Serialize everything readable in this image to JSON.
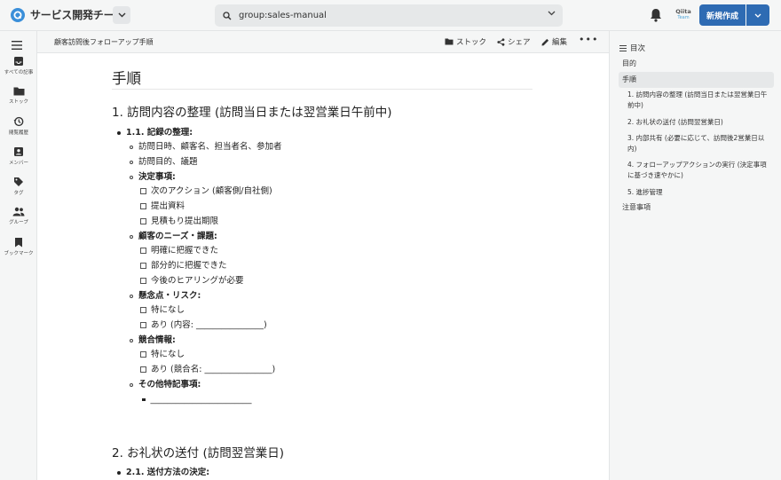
{
  "header": {
    "team_name": "サービス開発チーム",
    "search_value": "group:sales-manual",
    "qiita_brand": "Qiita",
    "qiita_sub": "Team",
    "new_button": "新規作成",
    "accent_color": "#2e6bb3"
  },
  "sidebar": {
    "items": [
      {
        "icon": "inbox-icon",
        "label": "すべての記事"
      },
      {
        "icon": "folder-icon",
        "label": "ストック"
      },
      {
        "icon": "history-icon",
        "label": "閲覧履歴"
      },
      {
        "icon": "member-icon",
        "label": "メンバー"
      },
      {
        "icon": "tag-icon",
        "label": "タグ"
      },
      {
        "icon": "group-icon",
        "label": "グループ"
      },
      {
        "icon": "bookmark-icon",
        "label": "ブックマーク"
      }
    ]
  },
  "docbar": {
    "title": "顧客訪問後フォローアップ手順",
    "stock": "ストック",
    "share": "シェア",
    "edit": "編集",
    "more": "•••"
  },
  "article": {
    "h1": "手順",
    "s1_heading": "1. 訪問内容の整理 (訪問当日または翌営業日午前中)",
    "s1_1": "1.1. 記録の整理:",
    "l_a": "訪問日時、顧客名、担当者名、参加者",
    "l_b": "訪問目的、議題",
    "l_c": "決定事項:",
    "c1": "次のアクション (顧客側/自社側)",
    "c2": "提出資料",
    "c3": "見積もり提出期限",
    "l_d": "顧客のニーズ・課題:",
    "c4": "明確に把握できた",
    "c5": "部分的に把握できた",
    "c6": "今後のヒアリングが必要",
    "l_e": "懸念点・リスク:",
    "c7": "特になし",
    "c8": "あり (内容: ________________)",
    "l_f": "競合情報:",
    "c9": "特になし",
    "c10": "あり (競合名: ________________)",
    "l_g": "その他特記事項:",
    "blank": "________________________",
    "s2_heading": "2. お礼状の送付 (訪問翌営業日)",
    "s2_1": "2.1. 送付方法の決定:"
  },
  "toc": {
    "title": "目次",
    "items": [
      "目的",
      "手順",
      "1. 訪問内容の整理 (訪問当日または翌営業日午前中)",
      "2. お礼状の送付 (訪問翌営業日)",
      "3. 内部共有 (必要に応じて、訪問後2営業日以内)",
      "4. フォローアップアクションの実行 (決定事項に基づき速やかに)",
      "5. 進捗管理",
      "注意事項"
    ]
  }
}
